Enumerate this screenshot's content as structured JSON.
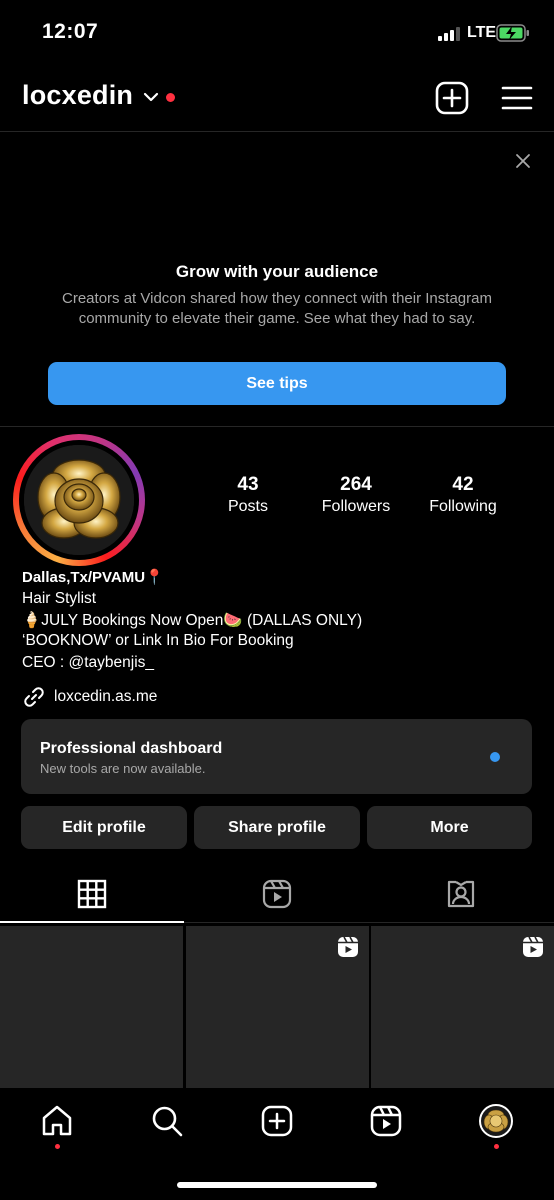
{
  "status_bar": {
    "time": "12:07",
    "network": "LTE"
  },
  "header": {
    "username": "locxedin"
  },
  "banner": {
    "title": "Grow with your audience",
    "body": "Creators at Vidcon shared how they connect with their Instagram community to elevate their game. See what they had to say.",
    "button": "See tips"
  },
  "stats": [
    {
      "value": "43",
      "label": "Posts"
    },
    {
      "value": "264",
      "label": "Followers"
    },
    {
      "value": "42",
      "label": "Following"
    }
  ],
  "bio": {
    "name": "Dallas,Tx/PVAMU📍",
    "lines": [
      "Hair Stylist",
      "🍦JULY Bookings Now Open🍉 (DALLAS ONLY)",
      "‘BOOKNOW’ or Link In Bio For Booking",
      "CEO : @taybenjis_"
    ],
    "link": "loxcedin.as.me"
  },
  "dashboard": {
    "title": "Professional dashboard",
    "subtitle": "New tools are now available."
  },
  "profile_buttons": {
    "edit": "Edit profile",
    "share": "Share profile",
    "more": "More"
  },
  "colors": {
    "accent": "#3797f0",
    "notification": "#ff3040",
    "surface": "#262626"
  }
}
